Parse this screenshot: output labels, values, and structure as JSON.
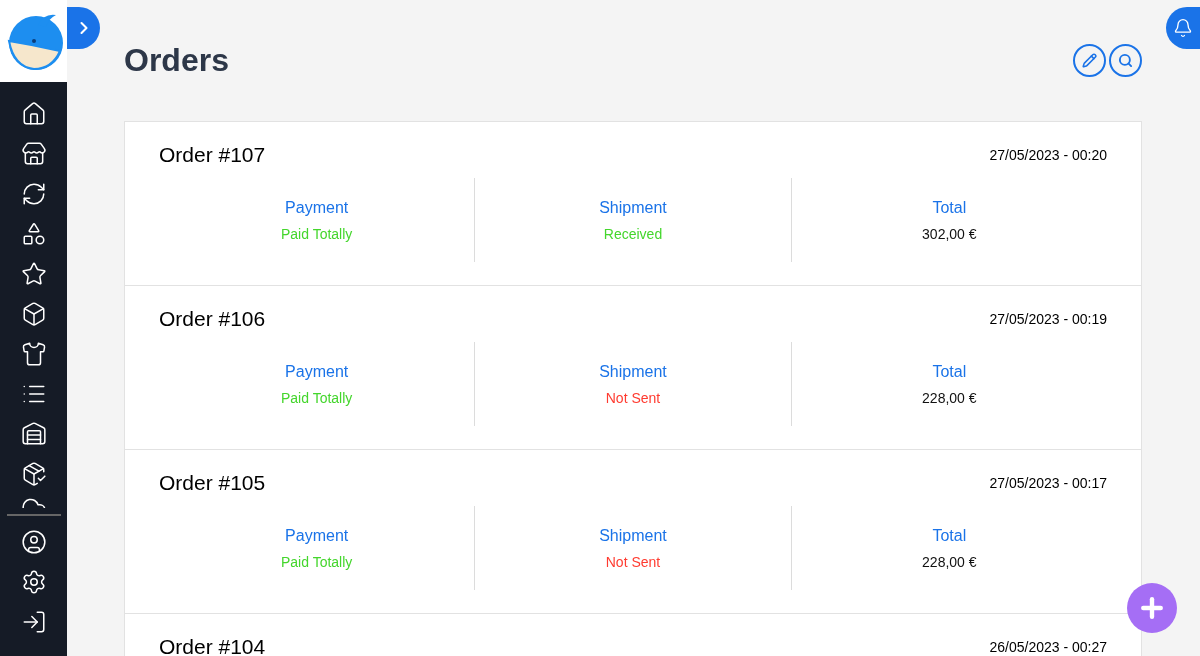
{
  "page": {
    "title": "Orders"
  },
  "orders": [
    {
      "title": "Order #107",
      "date": "27/05/2023 - 00:20",
      "payment": {
        "label": "Payment",
        "status": "Paid Totally",
        "color": "#44d62c"
      },
      "shipment": {
        "label": "Shipment",
        "status": "Received",
        "color": "#44d62c"
      },
      "total": {
        "label": "Total",
        "value": "302,00 €"
      }
    },
    {
      "title": "Order #106",
      "date": "27/05/2023 - 00:19",
      "payment": {
        "label": "Payment",
        "status": "Paid Totally",
        "color": "#44d62c"
      },
      "shipment": {
        "label": "Shipment",
        "status": "Not Sent",
        "color": "#ff3b30"
      },
      "total": {
        "label": "Total",
        "value": "228,00 €"
      }
    },
    {
      "title": "Order #105",
      "date": "27/05/2023 - 00:17",
      "payment": {
        "label": "Payment",
        "status": "Paid Totally",
        "color": "#44d62c"
      },
      "shipment": {
        "label": "Shipment",
        "status": "Not Sent",
        "color": "#ff3b30"
      },
      "total": {
        "label": "Total",
        "value": "228,00 €"
      }
    },
    {
      "title": "Order #104",
      "date": "26/05/2023 - 00:27"
    }
  ]
}
